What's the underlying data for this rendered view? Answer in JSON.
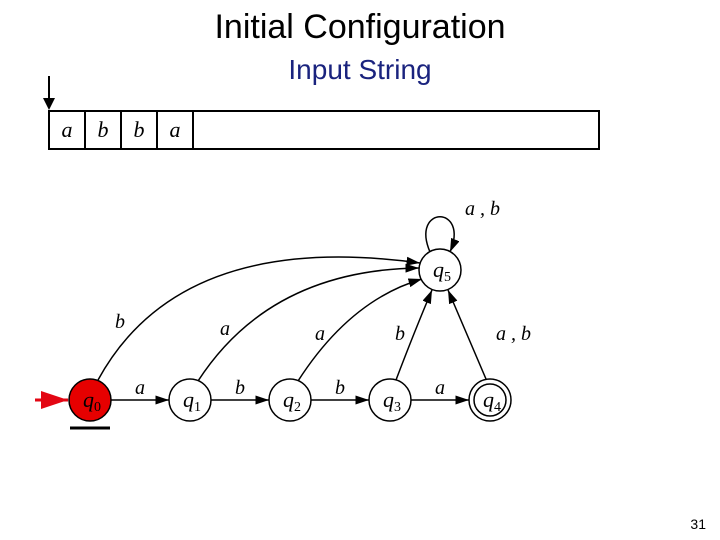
{
  "title": "Initial Configuration",
  "subtitle": "Input String",
  "tape": {
    "cells": [
      "a",
      "b",
      "b",
      "a",
      ""
    ]
  },
  "automaton": {
    "states": {
      "q0": {
        "q": "q",
        "sub": "0",
        "initial": true,
        "accepting": false,
        "highlight": true
      },
      "q1": {
        "q": "q",
        "sub": "1",
        "initial": false,
        "accepting": false,
        "highlight": false
      },
      "q2": {
        "q": "q",
        "sub": "2",
        "initial": false,
        "accepting": false,
        "highlight": false
      },
      "q3": {
        "q": "q",
        "sub": "3",
        "initial": false,
        "accepting": false,
        "highlight": false
      },
      "q4": {
        "q": "q",
        "sub": "4",
        "initial": false,
        "accepting": true,
        "highlight": false
      },
      "q5": {
        "q": "q",
        "sub": "5",
        "initial": false,
        "accepting": false,
        "highlight": false
      }
    },
    "edges": {
      "q0_q1": "a",
      "q1_q2": "b",
      "q2_q3": "b",
      "q3_q4": "a",
      "q0_q5": "b",
      "q1_q5": "a",
      "q2_q5": "a",
      "q3_q5": "b",
      "q4_q5": "a , b",
      "q5_q5": "a , b"
    }
  },
  "page_number": "31"
}
